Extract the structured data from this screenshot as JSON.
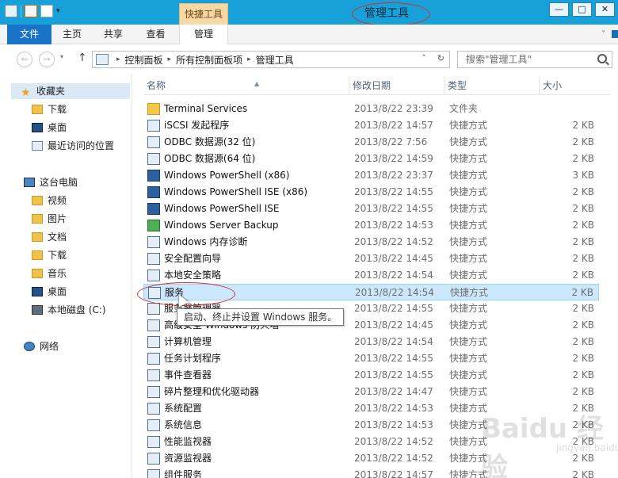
{
  "window": {
    "title": "管理工具",
    "context_tab": "快捷工具"
  },
  "ribbon": {
    "tabs": [
      "文件",
      "主页",
      "共享",
      "查看",
      "管理"
    ]
  },
  "address": {
    "crumbs": [
      "控制面板",
      "所有控制面板项",
      "管理工具"
    ],
    "search_placeholder": "搜索\"管理工具\""
  },
  "nav": {
    "items": [
      {
        "label": "收藏夹",
        "icon": "star-icon"
      },
      {
        "label": "下载",
        "icon": "folder-icon"
      },
      {
        "label": "桌面",
        "icon": "desktop-icon"
      },
      {
        "label": "最近访问的位置",
        "icon": "recent-icon"
      },
      {
        "label": "这台电脑",
        "icon": "computer-icon"
      },
      {
        "label": "视频",
        "icon": "folder-icon"
      },
      {
        "label": "图片",
        "icon": "folder-icon"
      },
      {
        "label": "文档",
        "icon": "folder-icon"
      },
      {
        "label": "下载",
        "icon": "folder-icon"
      },
      {
        "label": "音乐",
        "icon": "folder-icon"
      },
      {
        "label": "桌面",
        "icon": "desktop-icon"
      },
      {
        "label": "本地磁盘 (C:)",
        "icon": "drive-icon"
      },
      {
        "label": "网络",
        "icon": "network-icon"
      }
    ]
  },
  "columns": {
    "name": "名称",
    "date": "修改日期",
    "type": "类型",
    "size": "大小"
  },
  "files": [
    {
      "name": "Terminal Services",
      "date": "2013/8/22 23:39",
      "type": "文件夹",
      "size": ""
    },
    {
      "name": "iSCSI 发起程序",
      "date": "2013/8/22 14:57",
      "type": "快捷方式",
      "size": "2 KB"
    },
    {
      "name": "ODBC 数据源(32 位)",
      "date": "2013/8/22 7:56",
      "type": "快捷方式",
      "size": "2 KB"
    },
    {
      "name": "ODBC 数据源(64 位)",
      "date": "2013/8/22 14:59",
      "type": "快捷方式",
      "size": "2 KB"
    },
    {
      "name": "Windows PowerShell (x86)",
      "date": "2013/8/22 23:37",
      "type": "快捷方式",
      "size": "3 KB"
    },
    {
      "name": "Windows PowerShell ISE (x86)",
      "date": "2013/8/22 14:55",
      "type": "快捷方式",
      "size": "2 KB"
    },
    {
      "name": "Windows PowerShell ISE",
      "date": "2013/8/22 14:55",
      "type": "快捷方式",
      "size": "2 KB"
    },
    {
      "name": "Windows Server Backup",
      "date": "2013/8/22 14:53",
      "type": "快捷方式",
      "size": "2 KB"
    },
    {
      "name": "Windows 内存诊断",
      "date": "2013/8/22 14:52",
      "type": "快捷方式",
      "size": "2 KB"
    },
    {
      "name": "安全配置向导",
      "date": "2013/8/22 14:45",
      "type": "快捷方式",
      "size": "2 KB"
    },
    {
      "name": "本地安全策略",
      "date": "2013/8/22 14:54",
      "type": "快捷方式",
      "size": "2 KB"
    },
    {
      "name": "服务",
      "date": "2013/8/22 14:54",
      "type": "快捷方式",
      "size": "2 KB"
    },
    {
      "name": "服务器管理器",
      "date": "2013/8/22 14:55",
      "type": "快捷方式",
      "size": "2 KB"
    },
    {
      "name": "高级安全 Windows 防火墙",
      "date": "2013/8/22 14:45",
      "type": "快捷方式",
      "size": "2 KB"
    },
    {
      "name": "计算机管理",
      "date": "2013/8/22 14:54",
      "type": "快捷方式",
      "size": "2 KB"
    },
    {
      "name": "任务计划程序",
      "date": "2013/8/22 14:55",
      "type": "快捷方式",
      "size": "2 KB"
    },
    {
      "name": "事件查看器",
      "date": "2013/8/22 14:55",
      "type": "快捷方式",
      "size": "2 KB"
    },
    {
      "name": "碎片整理和优化驱动器",
      "date": "2013/8/22 14:47",
      "type": "快捷方式",
      "size": "2 KB"
    },
    {
      "name": "系统配置",
      "date": "2013/8/22 14:53",
      "type": "快捷方式",
      "size": "2 KB"
    },
    {
      "name": "系统信息",
      "date": "2013/8/22 14:53",
      "type": "快捷方式",
      "size": "2 KB"
    },
    {
      "name": "性能监视器",
      "date": "2013/8/22 14:52",
      "type": "快捷方式",
      "size": "2 KB"
    },
    {
      "name": "资源监视器",
      "date": "2013/8/22 14:52",
      "type": "快捷方式",
      "size": "2 KB"
    },
    {
      "name": "组件服务",
      "date": "2013/8/22 14:57",
      "type": "快捷方式",
      "size": "2 KB"
    }
  ],
  "tooltip": "启动、终止并设置 Windows 服务。",
  "watermark": {
    "text": "Baidu 经验",
    "sub": "jingyan.baidu.com"
  }
}
